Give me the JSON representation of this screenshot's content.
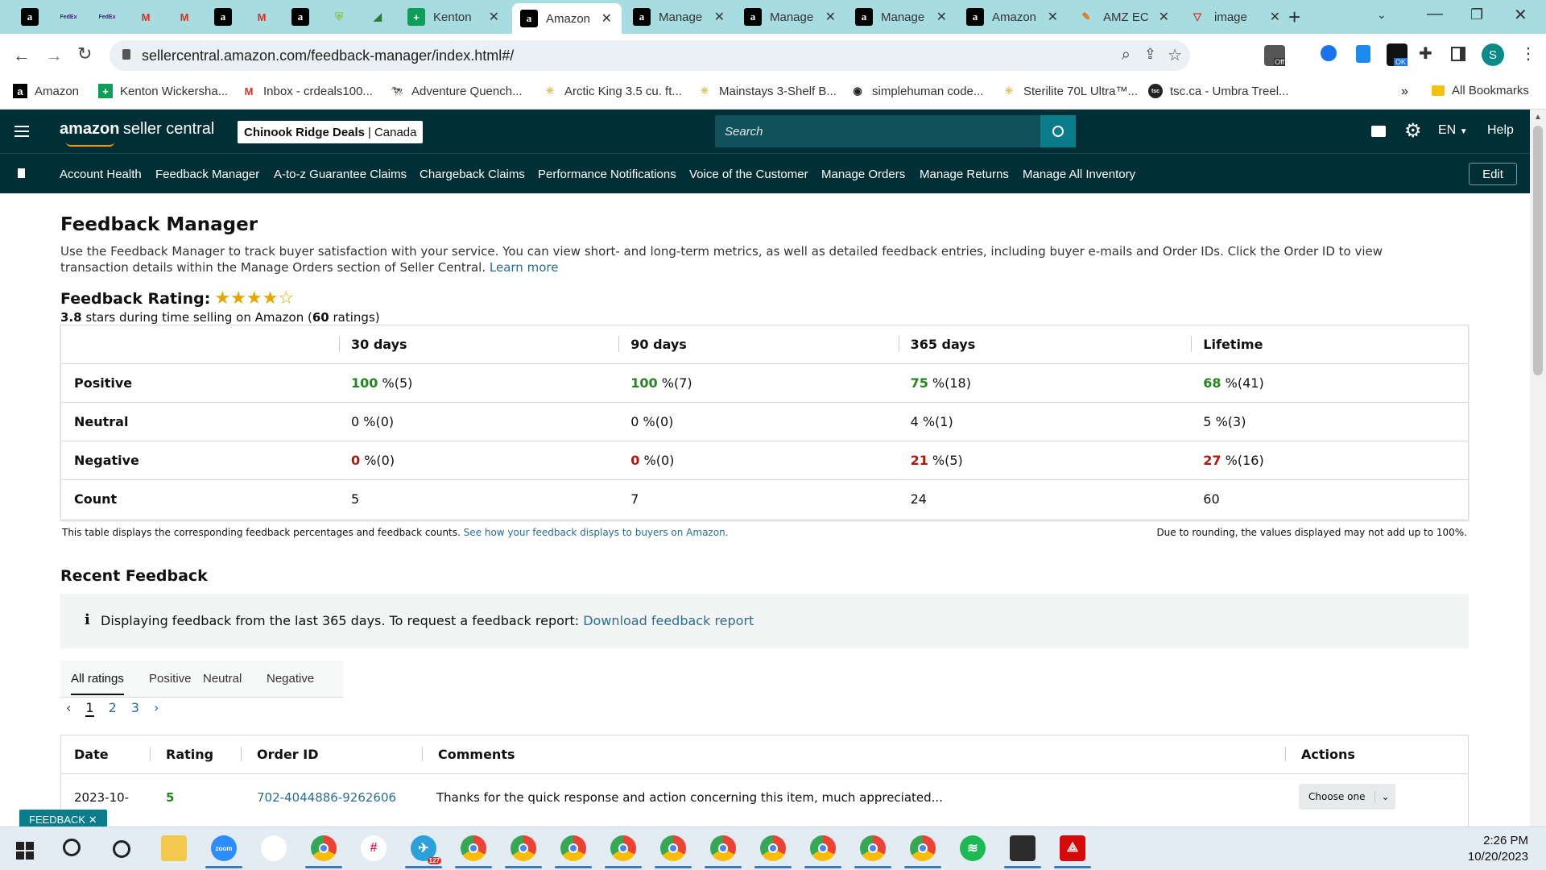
{
  "browser": {
    "tabs": [
      {
        "icon": "a",
        "label": ""
      },
      {
        "icon": "FedEx",
        "label": ""
      },
      {
        "icon": "FedEx",
        "label": ""
      },
      {
        "icon": "M",
        "label": ""
      },
      {
        "icon": "M",
        "label": ""
      },
      {
        "icon": "a",
        "label": ""
      },
      {
        "icon": "M",
        "label": ""
      },
      {
        "icon": "a",
        "label": ""
      },
      {
        "icon": "shield",
        "label": ""
      },
      {
        "icon": "leaf",
        "label": ""
      },
      {
        "icon": "+",
        "label": "Kenton"
      },
      {
        "icon": "a",
        "label": "Amazon"
      },
      {
        "icon": "a",
        "label": "Manage"
      },
      {
        "icon": "a",
        "label": "Manage"
      },
      {
        "icon": "a",
        "label": "Manage"
      },
      {
        "icon": "a",
        "label": "Amazon"
      },
      {
        "icon": "pen",
        "label": "AMZ EC"
      },
      {
        "icon": "v",
        "label": "image"
      }
    ],
    "url": "sellercentral.amazon.com/feedback-manager/index.html#/",
    "bookmarks": [
      "Amazon",
      "Kenton Wickersha...",
      "Inbox - crdeals100...",
      "Adventure Quench...",
      "Arctic King 3.5 cu. ft...",
      "Mainstays 3-Shelf B...",
      "simplehuman code...",
      "Sterilite 70L Ultra™...",
      "tsc.ca - Umbra Treel..."
    ],
    "all_bookmarks": "All Bookmarks",
    "more": "»",
    "ext_badges": {
      "off": "Off",
      "ok": "OK"
    },
    "profile": "S"
  },
  "header": {
    "logo_main": "amazon",
    "logo_sub": "seller central",
    "store_name": "Chinook Ridge Deals",
    "store_region": "Canada",
    "search_placeholder": "Search",
    "lang": "EN",
    "help": "Help"
  },
  "subnav": {
    "links": [
      "Account Health",
      "Feedback Manager",
      "A-to-z Guarantee Claims",
      "Chargeback Claims",
      "Performance Notifications",
      "Voice of the Customer",
      "Manage Orders",
      "Manage Returns",
      "Manage All Inventory"
    ],
    "edit": "Edit"
  },
  "page": {
    "title": "Feedback Manager",
    "description": "Use the Feedback Manager to track buyer satisfaction with your service. You can view short- and long-term metrics, as well as detailed feedback entries, including buyer e-mails and Order IDs. Click the Order ID to view transaction details within the Manage Orders section of Seller Central.",
    "learn_more": "Learn more",
    "rating_label": "Feedback Rating:",
    "rating_stars": 4,
    "rating_value": "3.8",
    "rating_text_mid": "stars during time selling on Amazon (",
    "rating_count": "60",
    "rating_text_end": "ratings)",
    "table": {
      "columns": [
        "30 days",
        "90 days",
        "365 days",
        "Lifetime"
      ],
      "rows": [
        {
          "label": "Positive",
          "cells": [
            [
              "100",
              " %(5)"
            ],
            [
              "100",
              " %(7)"
            ],
            [
              "75",
              " %(18)"
            ],
            [
              "68",
              " %(41)"
            ]
          ]
        },
        {
          "label": "Neutral",
          "cells": [
            [
              "0",
              " %(0)"
            ],
            [
              "0",
              " %(0)"
            ],
            [
              "4",
              " %(1)"
            ],
            [
              "5",
              " %(3)"
            ]
          ]
        },
        {
          "label": "Negative",
          "cells": [
            [
              "0",
              " %(0)"
            ],
            [
              "0",
              " %(0)"
            ],
            [
              "21",
              " %(5)"
            ],
            [
              "27",
              " %(16)"
            ]
          ]
        },
        {
          "label": "Count",
          "cells": [
            [
              "",
              "5"
            ],
            [
              "",
              "7"
            ],
            [
              "",
              "24"
            ],
            [
              "",
              "60"
            ]
          ]
        }
      ]
    },
    "table_note": "This table displays the corresponding feedback percentages and feedback counts.",
    "table_note_link": "See how your feedback displays to buyers on Amazon.",
    "rounding_note": "Due to rounding, the values displayed may not add up to 100%.",
    "recent_title": "Recent Feedback",
    "info_text": "Displaying feedback from the last 365 days. To request a feedback report:",
    "info_link": "Download feedback report",
    "tabs": [
      "All ratings",
      "Positive",
      "Neutral",
      "Negative"
    ],
    "pages": [
      "1",
      "2",
      "3"
    ],
    "recent_columns": [
      "Date",
      "Rating",
      "Order ID",
      "Comments",
      "Actions"
    ],
    "recent_rows": [
      {
        "date": "2023-10-",
        "rating": "5",
        "order": "702-4044886-9262606",
        "comment": "Thanks for the quick response and action concerning this item, much appreciated...",
        "action": "Choose one"
      }
    ],
    "feedback_tag": "FEEDBACK"
  },
  "taskbar": {
    "time": "2:26 PM",
    "date": "10/20/2023",
    "telegram_badge": "127",
    "zoom_label": "zoom"
  }
}
